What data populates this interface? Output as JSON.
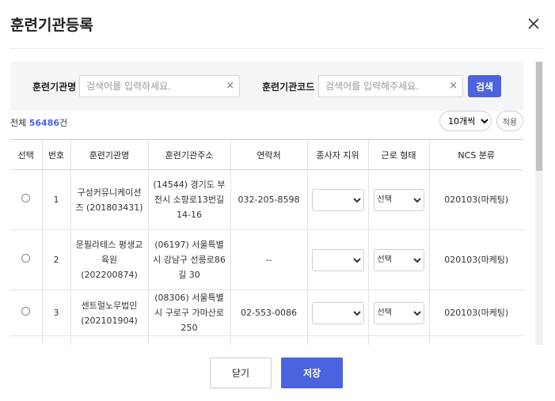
{
  "modal": {
    "title": "훈련기관등록"
  },
  "search": {
    "name_label": "훈련기관명",
    "name_placeholder": "검색어를 입력하세요.",
    "code_label": "훈련기관코드",
    "code_placeholder": "검색어를 입력해주세요.",
    "search_button": "검색",
    "clear_glyph": "×"
  },
  "summary": {
    "total_prefix": "전체",
    "total_count": "56486",
    "total_suffix": "건",
    "per_page": "10개씩",
    "apply_button": "적용"
  },
  "table": {
    "headers": [
      "선택",
      "번호",
      "훈련기관명",
      "훈련기관주소",
      "연락처",
      "종사자 지위",
      "근로 형태",
      "NCS 분류"
    ],
    "rows": [
      {
        "no": "1",
        "name": "구성커뮤니케이션즈 (201803431)",
        "address": "(14544) 경기도 부천시 소향로13번길 14-16",
        "phone": "032-205-8598",
        "position": "",
        "work_type": "선택",
        "ncs": "020103(마케팅)"
      },
      {
        "no": "2",
        "name": "문필라테스 평생교육원 (202200874)",
        "address": "(06197) 서울특별시 강남구 선릉로86길 30",
        "phone": "--",
        "position": "",
        "work_type": "선택",
        "ncs": "020103(마케팅)"
      },
      {
        "no": "3",
        "name": "센트럴노무법인 (202101904)",
        "address": "(08306) 서울특별시 구로구 가마산로 250",
        "phone": "02-553-0086",
        "position": "",
        "work_type": "선택",
        "ncs": "020103(마케팅)"
      }
    ]
  },
  "footer": {
    "close_button": "닫기",
    "save_button": "저장"
  }
}
